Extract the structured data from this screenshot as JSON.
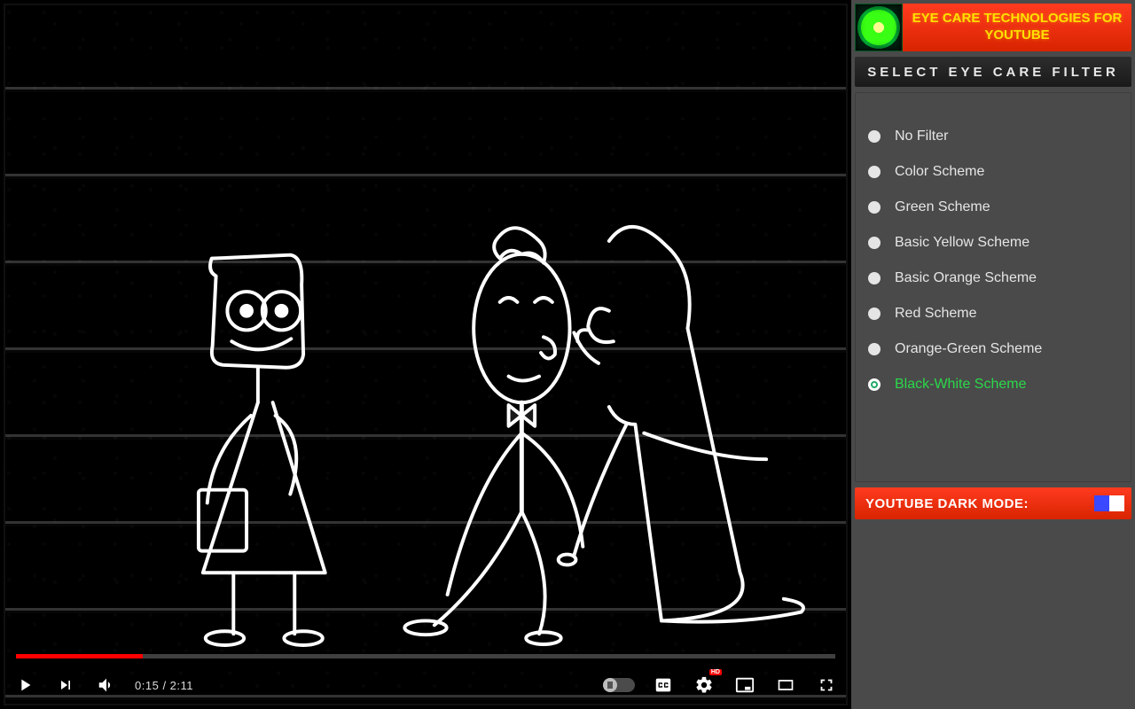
{
  "sidebar": {
    "brand_title": "EYE CARE TECHNOLOGIES FOR YOUTUBE",
    "select_label": "SELECT EYE CARE FILTER",
    "filters": [
      {
        "label": "No Filter",
        "selected": false
      },
      {
        "label": "Color Scheme",
        "selected": false
      },
      {
        "label": "Green Scheme",
        "selected": false
      },
      {
        "label": "Basic Yellow Scheme",
        "selected": false
      },
      {
        "label": "Basic Orange Scheme",
        "selected": false
      },
      {
        "label": "Red Scheme",
        "selected": false
      },
      {
        "label": "Orange-Green Scheme",
        "selected": false
      },
      {
        "label": "Black-White Scheme",
        "selected": true
      }
    ],
    "dark_mode_label": "YOUTUBE DARK MODE:",
    "dark_mode_on": true
  },
  "player": {
    "current_time": "0:15",
    "duration": "2:11",
    "progress_percent": 15.5,
    "hd_label": "HD",
    "autoplay_on": false
  }
}
